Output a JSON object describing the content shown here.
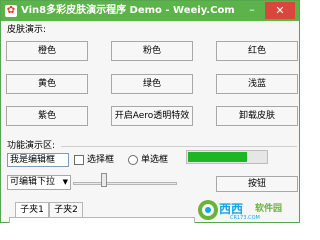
{
  "window": {
    "title": "Vin8多彩皮肤演示程序 Demo - Weeiy.Com",
    "icon": "palette-icon",
    "minimize_glyph": "–",
    "close_glyph": "✕"
  },
  "skin_section": {
    "label": "皮肤演示:",
    "buttons": [
      "橙色",
      "粉色",
      "红色",
      "黄色",
      "绿色",
      "浅蓝",
      "紫色",
      "开启Aero透明特效",
      "卸载皮肤"
    ]
  },
  "feature_section": {
    "label": "功能演示区:",
    "textbox_value": "我是编辑框",
    "checkbox_label": "选择框",
    "checkbox_checked": false,
    "radio_label": "单选框",
    "radio_selected": false,
    "progress_percent": 75,
    "combo_value": "可编辑下拉",
    "slider_fraction": 0.3,
    "button_label": "按钮",
    "tabs": [
      "子夹1",
      "子夹2"
    ]
  },
  "watermark": {
    "name": "西西",
    "sub": "软件园",
    "url": "CR173.COM"
  },
  "colors": {
    "titlebar": "#5cb34a",
    "close_button": "#d9463c",
    "progress": "#1fb523",
    "watermark_blue": "#12a8e0",
    "watermark_green": "#6ab23a"
  }
}
